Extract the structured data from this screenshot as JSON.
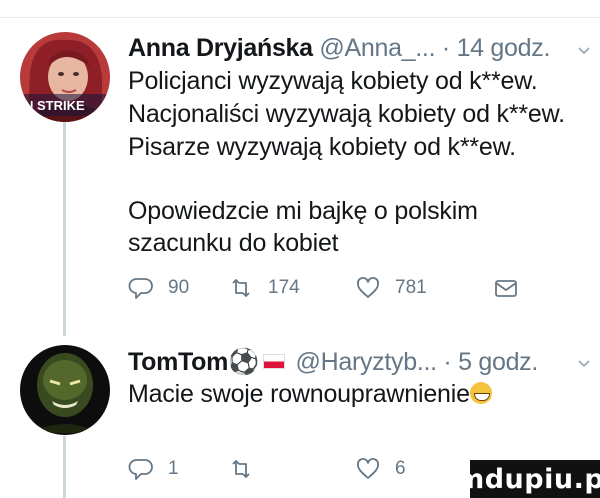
{
  "tweet1": {
    "author_name": "Anna Dryjańska",
    "handle": "@Anna_...",
    "separator": "·",
    "time": "14 godz.",
    "avatar_badge": "N STRIKE",
    "lines": [
      "Policjanci wyzywają kobiety od k**ew.",
      "Nacjonaliści wyzywają kobiety od k**ew.",
      "Pisarze wyzywają kobiety od k**ew.",
      "",
      "Opowiedzcie mi bajkę o polskim",
      "szacunku do kobiet"
    ],
    "replies": "90",
    "retweets": "174",
    "likes": "781"
  },
  "tweet2": {
    "author_name": "TomTom",
    "name_emoji": "⚽",
    "handle": "@Haryztyb...",
    "separator": "·",
    "time": "5 godz.",
    "text": "Macie swoje rownouprawnienie",
    "replies": "1",
    "retweets": "",
    "likes": "6"
  },
  "watermark": "mdupiu.pl",
  "colors": {
    "meta": "#657786",
    "line": "#ccd6dd",
    "text": "#14171a"
  }
}
